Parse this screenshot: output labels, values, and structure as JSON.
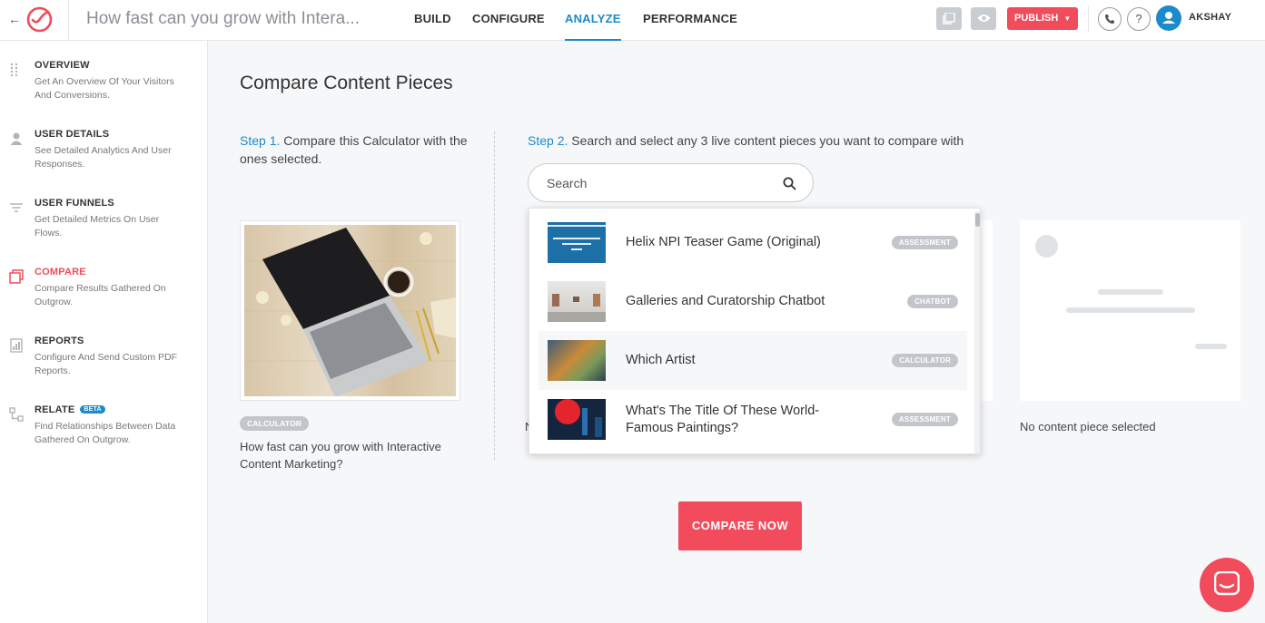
{
  "topbar": {
    "title": "How fast can you grow with Intera...",
    "nav": [
      "BUILD",
      "CONFIGURE",
      "ANALYZE",
      "PERFORMANCE"
    ],
    "active_nav": "ANALYZE",
    "publish_label": "PUBLISH",
    "help_label": "?",
    "username": "AKSHAY"
  },
  "sidebar": {
    "items": [
      {
        "title": "OVERVIEW",
        "desc": "Get An Overview Of Your Visitors And Conversions.",
        "icon": "grid-dots-icon"
      },
      {
        "title": "USER DETAILS",
        "desc": "See Detailed Analytics And User Responses.",
        "icon": "user-icon"
      },
      {
        "title": "USER FUNNELS",
        "desc": "Get Detailed Metrics On User Flows.",
        "icon": "funnel-icon"
      },
      {
        "title": "COMPARE",
        "desc": "Compare Results Gathered On Outgrow.",
        "icon": "compare-icon",
        "active": true
      },
      {
        "title": "REPORTS",
        "desc": "Configure And Send Custom PDF Reports.",
        "icon": "report-icon"
      },
      {
        "title": "RELATE",
        "badge": "BETA",
        "desc": "Find Relationships Between Data Gathered On Outgrow.",
        "icon": "relate-icon"
      }
    ]
  },
  "main": {
    "title": "Compare Content Pieces",
    "step1_label": "Step 1.",
    "step1_text": "Compare this Calculator with the ones selected.",
    "step2_label": "Step 2.",
    "step2_text": "Search and select any 3 live content pieces you want to compare with",
    "current_card": {
      "tag": "CALCULATOR",
      "name": "How fast can you grow with Interactive Content Marketing?"
    },
    "search_placeholder": "Search",
    "results": [
      {
        "name": "Helix NPI Teaser Game (Original)",
        "tag": "ASSESSMENT"
      },
      {
        "name": "Galleries and Curatorship Chatbot",
        "tag": "CHATBOT"
      },
      {
        "name": "Which Artist",
        "tag": "CALCULATOR"
      },
      {
        "name": "What's The Title Of These World-Famous Paintings?",
        "tag": "ASSESSMENT"
      }
    ],
    "empty_slot_text": "No content piece selected",
    "hidden_slot_partial": "N",
    "compare_label": "COMPARE NOW"
  },
  "colors": {
    "accent": "#1c8bc9",
    "brand": "#f24b5c"
  }
}
